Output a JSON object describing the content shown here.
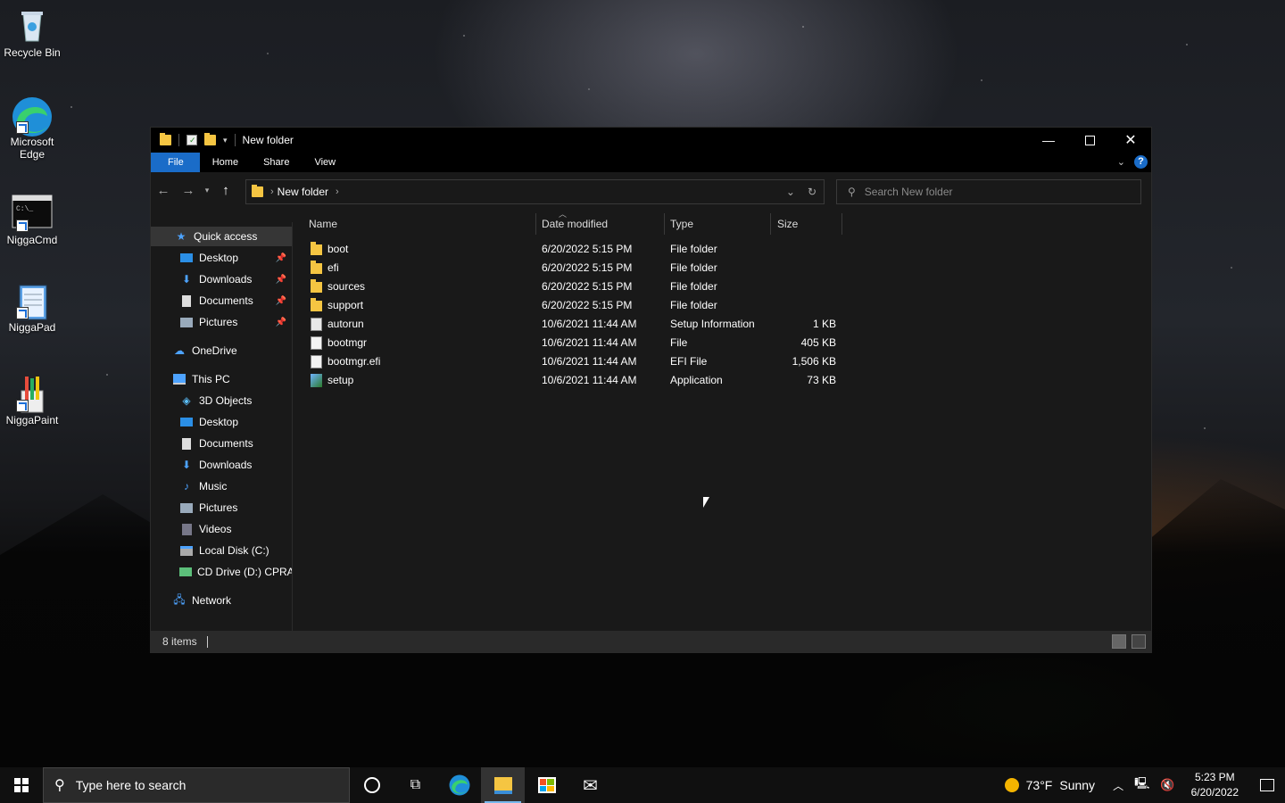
{
  "desktop": {
    "icons": [
      {
        "label": "Recycle Bin"
      },
      {
        "label": "Microsoft Edge"
      },
      {
        "label": "NiggaCmd"
      },
      {
        "label": "NiggaPad"
      },
      {
        "label": "NiggaPaint"
      }
    ]
  },
  "window": {
    "title": "New folder",
    "ribbon_tabs": [
      "File",
      "Home",
      "Share",
      "View"
    ],
    "address": {
      "crumb": "New folder"
    },
    "search_placeholder": "Search New folder",
    "nav": {
      "quick_access": "Quick access",
      "quick_items": [
        "Desktop",
        "Downloads",
        "Documents",
        "Pictures"
      ],
      "onedrive": "OneDrive",
      "this_pc": "This PC",
      "pc_items": [
        "3D Objects",
        "Desktop",
        "Documents",
        "Downloads",
        "Music",
        "Pictures",
        "Videos",
        "Local Disk (C:)",
        "CD Drive (D:) CPRA"
      ],
      "network": "Network"
    },
    "columns": {
      "name": "Name",
      "date": "Date modified",
      "type": "Type",
      "size": "Size"
    },
    "files": [
      {
        "name": "boot",
        "date": "6/20/2022 5:15 PM",
        "type": "File folder",
        "size": "",
        "icon": "folder-icon"
      },
      {
        "name": "efi",
        "date": "6/20/2022 5:15 PM",
        "type": "File folder",
        "size": "",
        "icon": "folder-icon"
      },
      {
        "name": "sources",
        "date": "6/20/2022 5:15 PM",
        "type": "File folder",
        "size": "",
        "icon": "folder-icon"
      },
      {
        "name": "support",
        "date": "6/20/2022 5:15 PM",
        "type": "File folder",
        "size": "",
        "icon": "folder-icon"
      },
      {
        "name": "autorun",
        "date": "10/6/2021 11:44 AM",
        "type": "Setup Information",
        "size": "1 KB",
        "icon": "setup-info-icon"
      },
      {
        "name": "bootmgr",
        "date": "10/6/2021 11:44 AM",
        "type": "File",
        "size": "405 KB",
        "icon": "file-icon"
      },
      {
        "name": "bootmgr.efi",
        "date": "10/6/2021 11:44 AM",
        "type": "EFI File",
        "size": "1,506 KB",
        "icon": "file-icon"
      },
      {
        "name": "setup",
        "date": "10/6/2021 11:44 AM",
        "type": "Application",
        "size": "73 KB",
        "icon": "application-icon"
      }
    ],
    "status": {
      "count": "8 items"
    }
  },
  "taskbar": {
    "search_placeholder": "Type here to search",
    "weather": {
      "temp": "73°F",
      "condition": "Sunny"
    },
    "clock": {
      "time": "5:23 PM",
      "date": "6/20/2022"
    }
  },
  "colors": {
    "accent": "#1a6cc8",
    "folder": "#f5c542"
  }
}
